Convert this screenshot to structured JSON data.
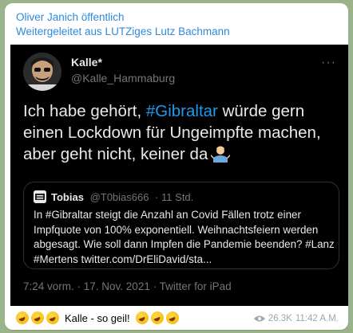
{
  "message": {
    "channel": "Oliver Janich öffentlich",
    "forwarded_from": "Weitergeleitet aus LUTZiges Lutz Bachmann",
    "caption_text": "Kalle - so geil!",
    "views": "26.3K",
    "time": "11:42 A.M."
  },
  "tweet": {
    "author_name": "Kalle*",
    "author_handle": "@Kalle_Hammaburg",
    "more": "···",
    "text_before": "Ich habe gehört, ",
    "hashtag": "#Gibraltar",
    "text_after": " würde gern einen Lockdown für Ungeimpfte machen, aber geht nicht, keiner da",
    "footer": "7:24 vorm. · 17. Nov. 2021 · Twitter for iPad",
    "quote": {
      "name": "Tobias",
      "handle": "@T0bias666",
      "time": "· 11 Std.",
      "text": "In #Gibraltar steigt die Anzahl an Covid Fällen trotz einer Impfquote von 100% exponentiell. Weihnachtsfeiern werden abgesagt. Wie soll dann Impfen die Pandemie beenden? #Lanz #Mertens twitter.com/DrEliDavid/sta..."
    }
  },
  "colors": {
    "channel_blue": "#2e8ad8",
    "tweet_bg": "#000000",
    "hashtag": "#1d9bf0"
  }
}
